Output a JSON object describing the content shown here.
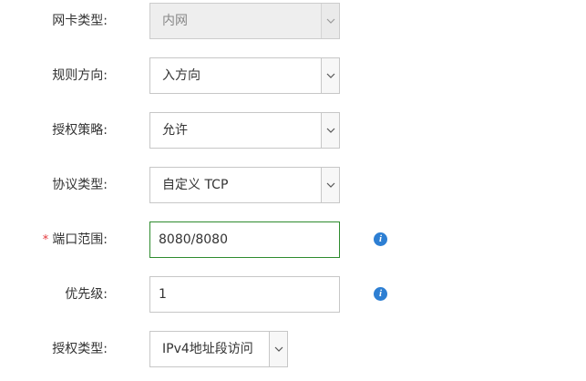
{
  "form": {
    "nic_type": {
      "label": "网卡类型:",
      "value": "内网",
      "disabled": true
    },
    "rule_direction": {
      "label": "规则方向:",
      "value": "入方向"
    },
    "auth_policy": {
      "label": "授权策略:",
      "value": "允许"
    },
    "protocol_type": {
      "label": "协议类型:",
      "value": "自定义 TCP"
    },
    "port_range": {
      "required_mark": "*",
      "label": "端口范围:",
      "value": "8080/8080",
      "info_icon": "info-icon"
    },
    "priority": {
      "label": "优先级:",
      "value": "1",
      "info_icon": "info-icon"
    },
    "auth_type": {
      "label": "授权类型:",
      "value": "IPv4地址段访问"
    }
  },
  "colors": {
    "focus_border": "#2e8b2e",
    "info_icon": "#2d7fd3",
    "required_star": "#e4393c"
  }
}
